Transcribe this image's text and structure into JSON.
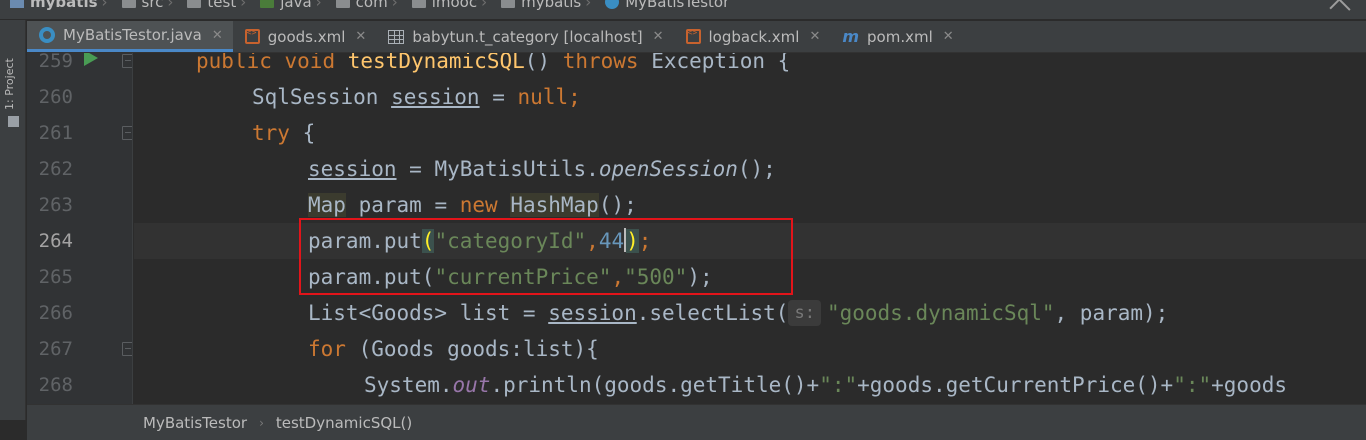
{
  "navbar": {
    "items": [
      "mybatis",
      "src",
      "test",
      "java",
      "com",
      "imooc",
      "mybatis",
      "MyBatisTestor"
    ]
  },
  "toolstrip": {
    "project_label": "1: Project"
  },
  "tabs": [
    {
      "label": "MyBatisTestor.java",
      "icon": "java-class-icon",
      "active": true
    },
    {
      "label": "goods.xml",
      "icon": "xml-file-icon",
      "active": false
    },
    {
      "label": "babytun.t_category [localhost]",
      "icon": "db-table-icon",
      "active": false
    },
    {
      "label": "logback.xml",
      "icon": "xml-file-icon",
      "active": false
    },
    {
      "label": "pom.xml",
      "icon": "maven-icon",
      "active": false
    }
  ],
  "colors": {
    "accent": "#4a88c7",
    "keyword": "#cc7832",
    "string": "#6a8759",
    "number": "#6897bb",
    "method_decl": "#ffc66d",
    "highlight_box": "#e2141a"
  },
  "editor": {
    "line_numbers": [
      "259",
      "260",
      "261",
      "262",
      "263",
      "264",
      "265",
      "266",
      "267",
      "268"
    ],
    "hint_label": "s:"
  },
  "code": {
    "l259": {
      "kw1": "public",
      "kw2": "void",
      "fn": "testDynamicSQL",
      "p": "() ",
      "kw3": "throws",
      "rest": " Exception {"
    },
    "l260": {
      "type": "SqlSession ",
      "var": "session",
      "eq": " = ",
      "kw": "null",
      "semi": ";"
    },
    "l261": {
      "kw": "try",
      "rest": " {"
    },
    "l262": {
      "var": "session",
      "eq": " = MyBatisUtils.",
      "m": "openSession",
      "rest": "();"
    },
    "l263": {
      "t1": "Map",
      "mid": " param = ",
      "kw": "new",
      "sp": " ",
      "t2": "HashMap",
      "rest": "();"
    },
    "l264": {
      "call": "param.put",
      "po": "(",
      "str": "\"categoryId\"",
      "comma": ",",
      "num": "44",
      "pc": ")",
      "semi": ";"
    },
    "l265": {
      "call": "param.put(",
      "str1": "\"currentPrice\"",
      "comma": ",",
      "str2": "\"500\"",
      "rest": ");"
    },
    "l266": {
      "pre": "List<Goods> list = ",
      "var": "session",
      "mid": ".selectList(",
      "str": "\"goods.dynamicSql\"",
      "rest": ", param);"
    },
    "l267": {
      "kw": "for",
      "rest": " (Goods goods:list){"
    },
    "l268": {
      "pre": "System.",
      "field": "out",
      "mid": ".println(goods.getTitle()+",
      "s1": "\":\"",
      "mid2": "+goods.getCurrentPrice()+",
      "s2": "\":\"",
      "rest": "+goods"
    }
  },
  "bottom": {
    "crumbs": [
      "MyBatisTestor",
      "testDynamicSQL()"
    ],
    "separator": "›"
  }
}
